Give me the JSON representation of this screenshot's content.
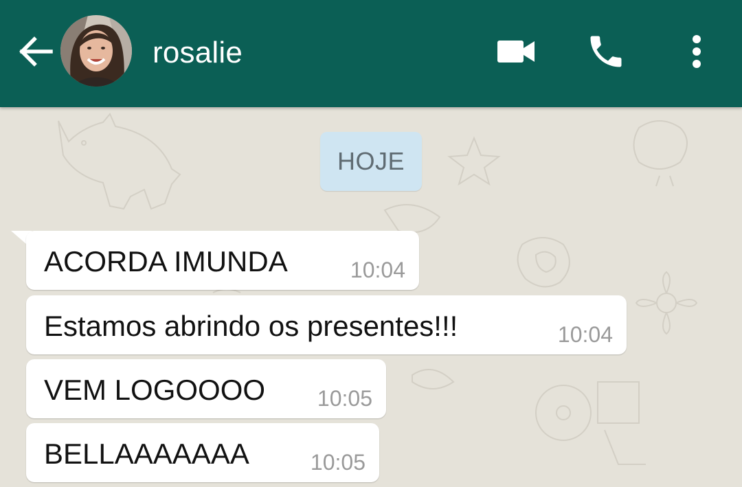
{
  "header": {
    "contact_name": "rosalie",
    "back_icon": "arrow-left-icon",
    "video_icon": "video-camera-icon",
    "call_icon": "phone-icon",
    "menu_icon": "more-vert-icon",
    "background_color": "#0b5f55"
  },
  "chat": {
    "date_label": "HOJE",
    "date_chip_color": "#cfe5f2",
    "messages": [
      {
        "text": "ACORDA IMUNDA",
        "time": "10:04"
      },
      {
        "text": "Estamos abrindo os presentes!!!",
        "time": "10:04"
      },
      {
        "text": "VEM LOGOOOO",
        "time": "10:05"
      },
      {
        "text": "BELLAAAAAAA",
        "time": "10:05"
      }
    ]
  }
}
